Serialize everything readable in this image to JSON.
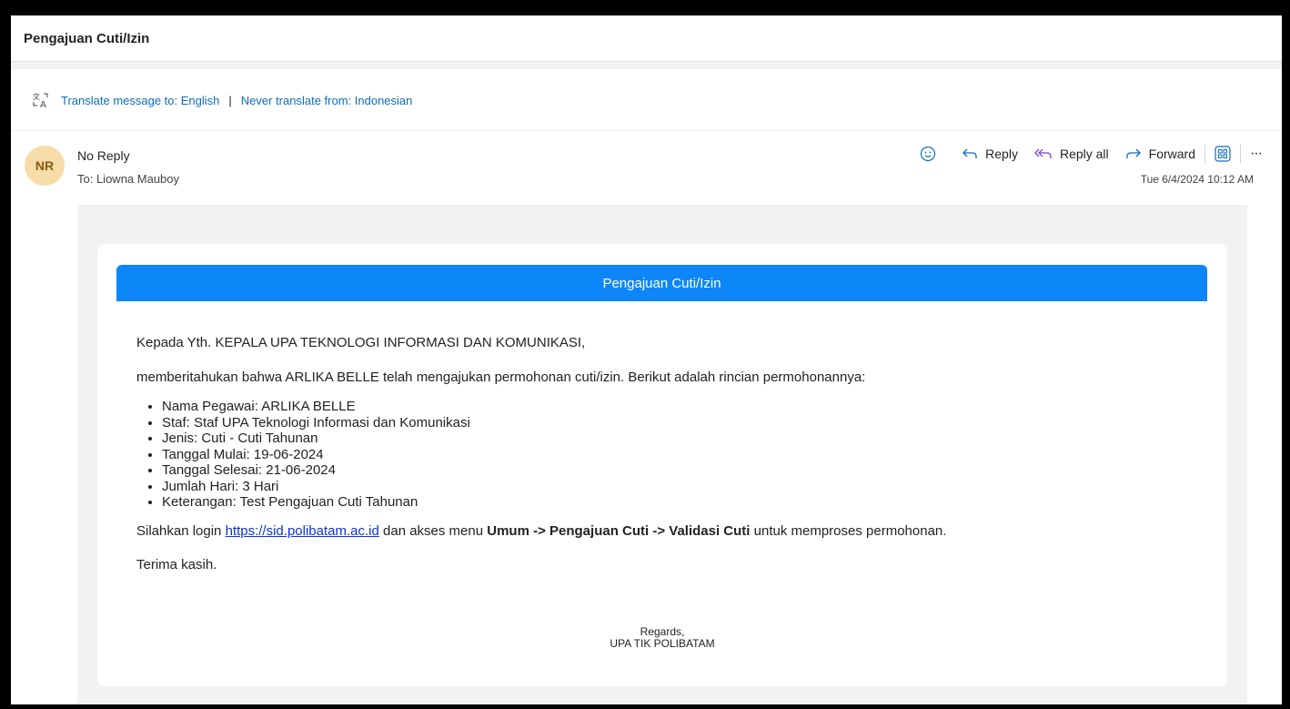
{
  "subject": "Pengajuan Cuti/Izin",
  "translate": {
    "translate_link": "Translate message to: English",
    "separator": "|",
    "never_link": "Never translate from: Indonesian"
  },
  "sender": {
    "initials": "NR",
    "name": "No Reply",
    "to": "To:  Liowna Mauboy",
    "timestamp": "Tue 6/4/2024 10:12 AM"
  },
  "actions": {
    "reply": "Reply",
    "reply_all": "Reply all",
    "forward": "Forward",
    "more": "···"
  },
  "email": {
    "header": "Pengajuan Cuti/Izin",
    "greeting": "Kepada Yth. KEPALA UPA TEKNOLOGI INFORMASI DAN KOMUNIKASI,",
    "intro": "memberitahukan bahwa ARLIKA BELLE telah mengajukan permohonan cuti/izin. Berikut adalah rincian permohonannya:",
    "details": [
      "Nama Pegawai: ARLIKA BELLE",
      "Staf: Staf UPA Teknologi Informasi dan Komunikasi",
      "Jenis: Cuti - Cuti Tahunan",
      "Tanggal Mulai: 19-06-2024",
      "Tanggal Selesai: 21-06-2024",
      "Jumlah Hari: 3 Hari",
      "Keterangan: Test Pengajuan Cuti Tahunan"
    ],
    "instruction_pre": "Silahkan login ",
    "link": "https://sid.polibatam.ac.id",
    "instruction_mid": " dan akses menu ",
    "menu_path": "Umum -> Pengajuan Cuti -> Validasi Cuti",
    "instruction_post": " untuk memproses permohonan.",
    "thanks": "Terima kasih.",
    "regards": "Regards,",
    "signature": "UPA TIK POLIBATAM"
  },
  "colors": {
    "header_blue": "#0d86f7",
    "link_blue": "#0f6cbd",
    "avatar_bg": "#f5dca8"
  }
}
